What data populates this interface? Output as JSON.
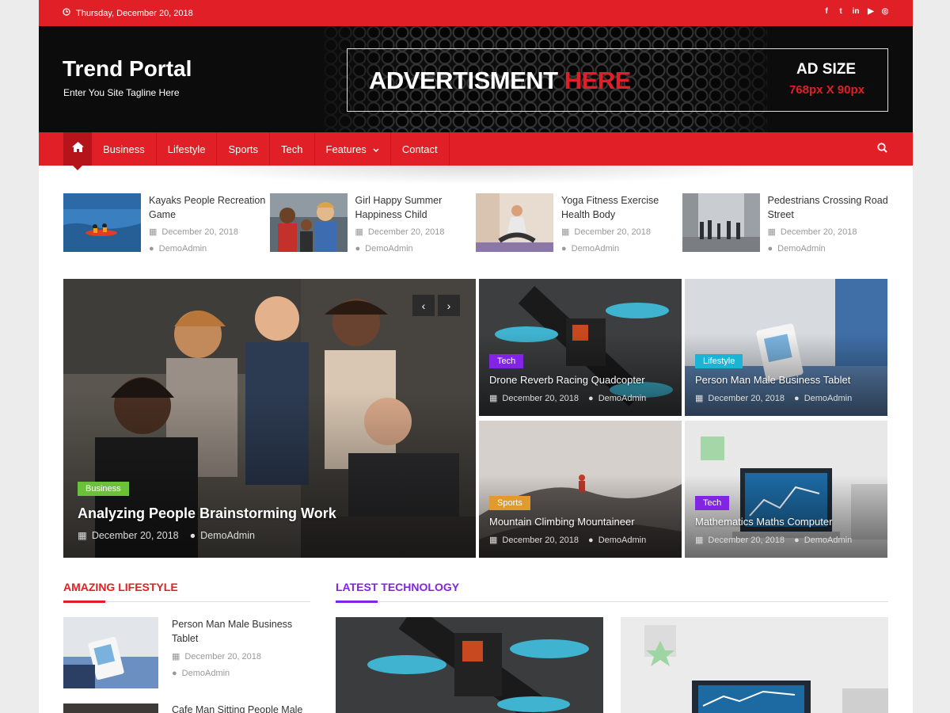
{
  "topbar": {
    "date": "Thursday, December 20, 2018",
    "social": [
      "facebook-icon",
      "twitter-icon",
      "linkedin-icon",
      "youtube-icon",
      "instagram-icon"
    ],
    "social_glyphs": [
      "f",
      "t",
      "in",
      "▶",
      "◎"
    ]
  },
  "header": {
    "site_title": "Trend Portal",
    "tagline": "Enter You Site Tagline Here",
    "ad_text": "ADVERTISMENT",
    "ad_text_red": "HERE",
    "ad_size_label": "AD SIZE",
    "ad_size_value": "768px X 90px"
  },
  "nav": {
    "items": [
      "Business",
      "Lifestyle",
      "Sports",
      "Tech",
      "Features",
      "Contact"
    ]
  },
  "small_posts": [
    {
      "title": "Kayaks People Recreation Game",
      "date": "December 20, 2018",
      "author": "DemoAdmin"
    },
    {
      "title": "Girl Happy Summer Happiness Child",
      "date": "December 20, 2018",
      "author": "DemoAdmin"
    },
    {
      "title": "Yoga Fitness Exercise Health Body",
      "date": "December 20, 2018",
      "author": "DemoAdmin"
    },
    {
      "title": "Pedestrians Crossing Road Street",
      "date": "December 20, 2018",
      "author": "DemoAdmin"
    }
  ],
  "featured_main": {
    "category": "Business",
    "title": "Analyzing People Brainstorming Work",
    "date": "December 20, 2018",
    "author": "DemoAdmin"
  },
  "featured_tiles": [
    {
      "category": "Tech",
      "title": "Drone Reverb Racing Quadcopter",
      "date": "December 20, 2018",
      "author": "DemoAdmin"
    },
    {
      "category": "Lifestyle",
      "title": "Person Man Male Business Tablet",
      "date": "December 20, 2018",
      "author": "DemoAdmin"
    },
    {
      "category": "Sports",
      "title": "Mountain Climbing Mountaineer",
      "date": "December 20, 2018",
      "author": "DemoAdmin"
    },
    {
      "category": "Tech",
      "title": "Mathematics Maths Computer",
      "date": "December 20, 2018",
      "author": "DemoAdmin"
    }
  ],
  "sections": {
    "lifestyle_title": "AMAZING LIFESTYLE",
    "technology_title": "LATEST TECHNOLOGY"
  },
  "lifestyle_posts": [
    {
      "title": "Person Man Male Business Tablet",
      "date": "December 20, 2018",
      "author": "DemoAdmin"
    },
    {
      "title": "Cafe Man Sitting People Male"
    }
  ],
  "colors": {
    "brand_red": "#e11f26",
    "tech_purple": "#8224e3",
    "lifestyle_cyan": "#1bb4d4",
    "business_green": "#6cc13a",
    "sports_orange": "#e09a2d"
  }
}
